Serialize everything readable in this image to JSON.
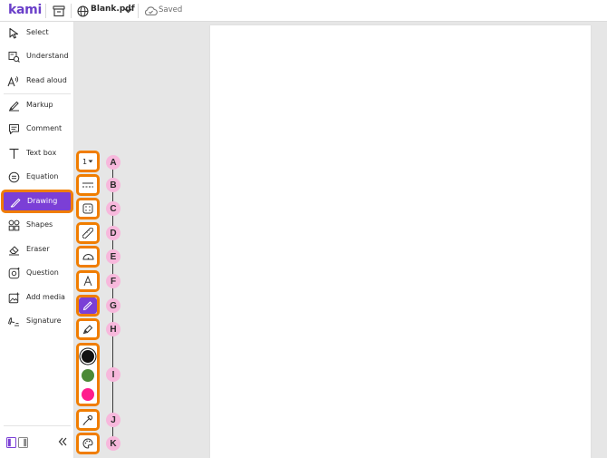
{
  "topbar": {
    "logo": "kami",
    "file_name": "Blank.pdf",
    "saved_status": "Saved",
    "icons": [
      "archive-icon",
      "globe-icon",
      "chevron-down-icon",
      "cloud-check-icon"
    ]
  },
  "sidebar": {
    "items": [
      {
        "label": "Select",
        "icon": "cursor-icon"
      },
      {
        "label": "Understand",
        "icon": "understand-icon"
      },
      {
        "label": "Read aloud",
        "icon": "read-aloud-icon"
      },
      {
        "label": "Markup",
        "icon": "markup-icon"
      },
      {
        "label": "Comment",
        "icon": "comment-icon"
      },
      {
        "label": "Text box",
        "icon": "text-box-icon"
      },
      {
        "label": "Equation",
        "icon": "equation-icon"
      },
      {
        "label": "Drawing",
        "icon": "pen-icon",
        "active": true
      },
      {
        "label": "Shapes",
        "icon": "shapes-icon"
      },
      {
        "label": "Eraser",
        "icon": "eraser-icon"
      },
      {
        "label": "Question",
        "icon": "question-icon"
      },
      {
        "label": "Add media",
        "icon": "add-media-icon"
      },
      {
        "label": "Signature",
        "icon": "signature-icon"
      }
    ]
  },
  "drawing_tools": {
    "stroke_size": "1",
    "colors": {
      "black": "#111111",
      "green": "#4c8a37",
      "pink": "#ff1c8d"
    },
    "accent": "#7b3fd6",
    "highlight": "#f07d00"
  },
  "callouts": [
    "A",
    "B",
    "C",
    "D",
    "E",
    "F",
    "G",
    "H",
    "I",
    "J",
    "K"
  ]
}
